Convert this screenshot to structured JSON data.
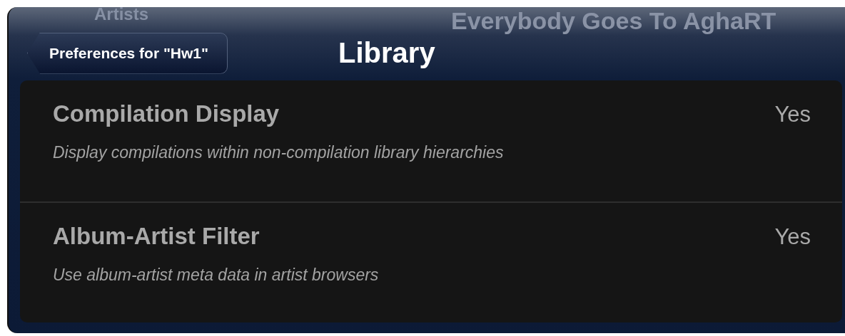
{
  "background": {
    "list_heading": "Artists",
    "album_title": "Everybody Goes To AghaRT"
  },
  "nav_bar": {
    "back_button": "Preferences for \"Hw1\"",
    "title": "Library"
  },
  "settings": [
    {
      "title": "Compilation Display",
      "value": "Yes",
      "description": "Display compilations within non-compilation library hierarchies"
    },
    {
      "title": "Album-Artist Filter",
      "value": "Yes",
      "description": "Use album-artist meta data in artist browsers"
    }
  ]
}
